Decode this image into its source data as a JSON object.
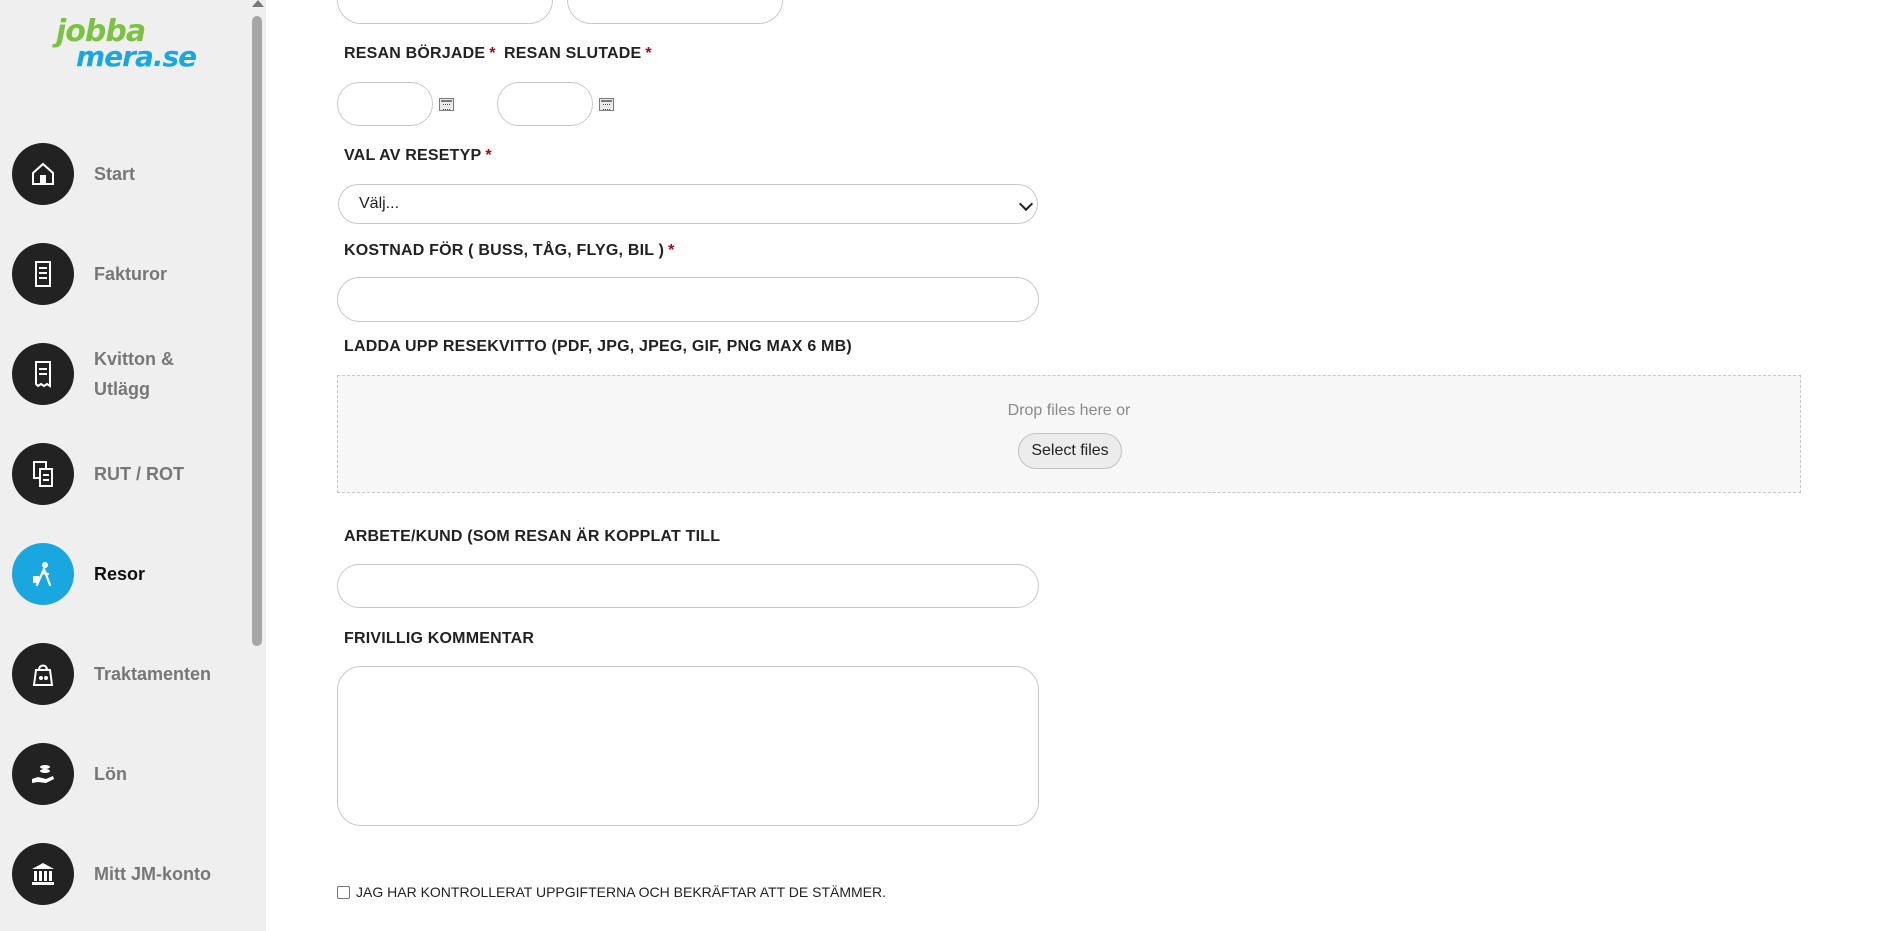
{
  "logo": {
    "line1": "jobba",
    "line2": "mera.se"
  },
  "sidebar": {
    "items": [
      {
        "label": "Start",
        "icon": "house-icon",
        "active": false
      },
      {
        "label": "Fakturor",
        "icon": "invoice-icon",
        "active": false
      },
      {
        "label": "Kvitton & Utlägg",
        "icon": "receipt-icon",
        "active": false
      },
      {
        "label": "RUT / ROT",
        "icon": "documents-icon",
        "active": false
      },
      {
        "label": "Resor",
        "icon": "traveler-icon",
        "active": true
      },
      {
        "label": "Traktamenten",
        "icon": "bag-icon",
        "active": false
      },
      {
        "label": "Lön",
        "icon": "salary-hand-icon",
        "active": false
      },
      {
        "label": "Mitt JM-konto",
        "icon": "bank-icon",
        "active": false
      }
    ]
  },
  "form": {
    "trip_started_label": "RESAN BÖRJADE",
    "trip_ended_label": "RESAN SLUTADE",
    "required_mark": "*",
    "trip_started_value": "",
    "trip_ended_value": "",
    "trip_type_label": "VAL AV RESETYP",
    "trip_type_selected": "Välj...",
    "cost_label": "KOSTNAD FÖR ( BUSS, TÅG, FLYG, BIL )",
    "cost_value": "",
    "upload_label": "LADDA UPP RESEKVITTO (PDF, JPG, JPEG, GIF, PNG MAX 6 MB)",
    "drop_text": "Drop files here or",
    "select_files": "Select files",
    "work_client_label": "ARBETE/KUND (SOM RESAN ÄR KOPPLAT TILL",
    "work_client_value": "",
    "comment_label": "FRIVILLIG KOMMENTAR",
    "comment_value": "",
    "confirm_label": "JAG HAR KONTROLLERAT UPPGIFTERNA OCH BEKRÄFTAR ATT DE STÄMMER."
  },
  "colors": {
    "accent": "#1aa7e0",
    "logo_green": "#7cc242",
    "required": "#b00020"
  }
}
